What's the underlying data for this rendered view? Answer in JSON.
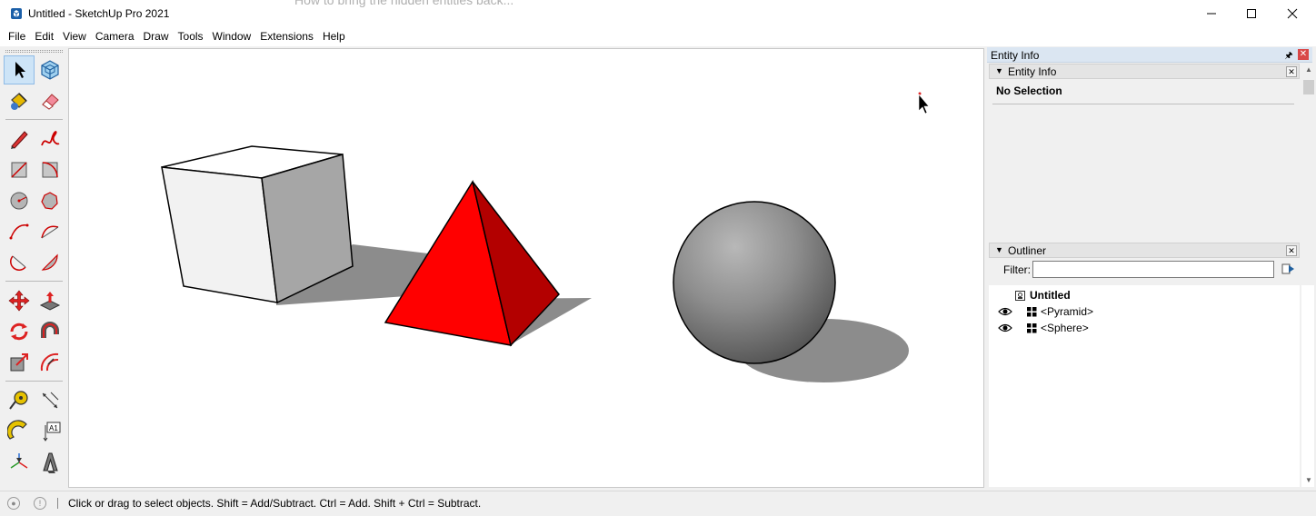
{
  "window": {
    "title": "Untitled - SketchUp Pro 2021",
    "overlay_ghost_text": "How to bring the hidden entities back..."
  },
  "menubar": {
    "items": [
      {
        "label": "File"
      },
      {
        "label": "Edit"
      },
      {
        "label": "View"
      },
      {
        "label": "Camera"
      },
      {
        "label": "Draw"
      },
      {
        "label": "Tools"
      },
      {
        "label": "Window"
      },
      {
        "label": "Extensions"
      },
      {
        "label": "Help"
      }
    ]
  },
  "toolbar": {
    "tools": [
      "select-tool",
      "component-tool",
      "paint-bucket-tool",
      "eraser-tool",
      "line-tool",
      "freehand-tool",
      "rectangle-tool",
      "rotated-rectangle-tool",
      "circle-tool",
      "polygon-tool",
      "arc-tool",
      "two-point-arc-tool",
      "three-point-arc-tool",
      "pie-tool",
      "move-tool",
      "push-pull-tool",
      "rotate-tool",
      "follow-me-tool",
      "scale-tool",
      "offset-tool",
      "tape-measure-tool",
      "dimension-tool",
      "protractor-tool",
      "text-tool",
      "axes-tool",
      "3d-text-tool"
    ],
    "text_tool_label": "A1"
  },
  "scene": {
    "objects": [
      "cube",
      "pyramid",
      "sphere"
    ],
    "colors": {
      "pyramid_front": "#ff0000",
      "pyramid_side": "#b30000",
      "shadow": "#8c8c8c"
    }
  },
  "tray": {
    "title": "Entity Info",
    "entity_info": {
      "header": "Entity Info",
      "selection_text": "No Selection"
    },
    "outliner": {
      "header": "Outliner",
      "filter_label": "Filter:",
      "filter_value": "",
      "root": "Untitled",
      "items": [
        {
          "label": "<Pyramid>",
          "visible": true
        },
        {
          "label": "<Sphere>",
          "visible": true
        }
      ]
    }
  },
  "statusbar": {
    "text": "Click or drag to select objects. Shift = Add/Subtract. Ctrl = Add. Shift + Ctrl = Subtract."
  }
}
